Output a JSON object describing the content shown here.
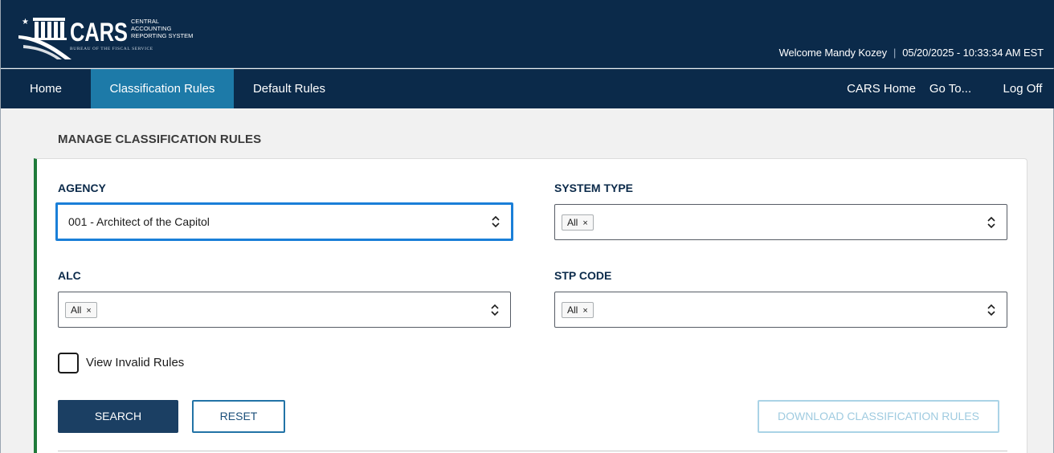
{
  "header": {
    "logo_main": "CARS",
    "logo_sub": [
      "CENTRAL",
      "ACCOUNTING",
      "REPORTING SYSTEM"
    ],
    "logo_bureau": "BUREAU OF THE FISCAL SERVICE",
    "welcome": "Welcome Mandy Kozey",
    "separator": "|",
    "datetime": "05/20/2025 - 10:33:34 AM EST"
  },
  "nav": {
    "left": [
      {
        "label": "Home"
      },
      {
        "label": "Classification Rules"
      },
      {
        "label": "Default Rules"
      }
    ],
    "right": [
      {
        "label": "CARS Home"
      },
      {
        "label": "Go To..."
      },
      {
        "label": "Log Off"
      }
    ]
  },
  "page": {
    "title": "MANAGE CLASSIFICATION RULES"
  },
  "form": {
    "agency": {
      "label": "AGENCY",
      "value": "001 - Architect of the Capitol"
    },
    "system_type": {
      "label": "SYSTEM TYPE",
      "chip": "All",
      "chip_remove": "×"
    },
    "alc": {
      "label": "ALC",
      "chip": "All",
      "chip_remove": "×"
    },
    "stp_code": {
      "label": "STP CODE",
      "chip": "All",
      "chip_remove": "×"
    },
    "view_invalid": {
      "label": "View Invalid Rules",
      "checked": false
    }
  },
  "buttons": {
    "search": "SEARCH",
    "reset": "RESET",
    "download": "DOWNLOAD CLASSIFICATION RULES"
  },
  "colors": {
    "header_bg": "#0b2a4a",
    "nav_active": "#1d7aa8",
    "card_accent": "#1f7a3a",
    "focus": "#1a7fd8",
    "primary_button": "#1b3f63"
  }
}
